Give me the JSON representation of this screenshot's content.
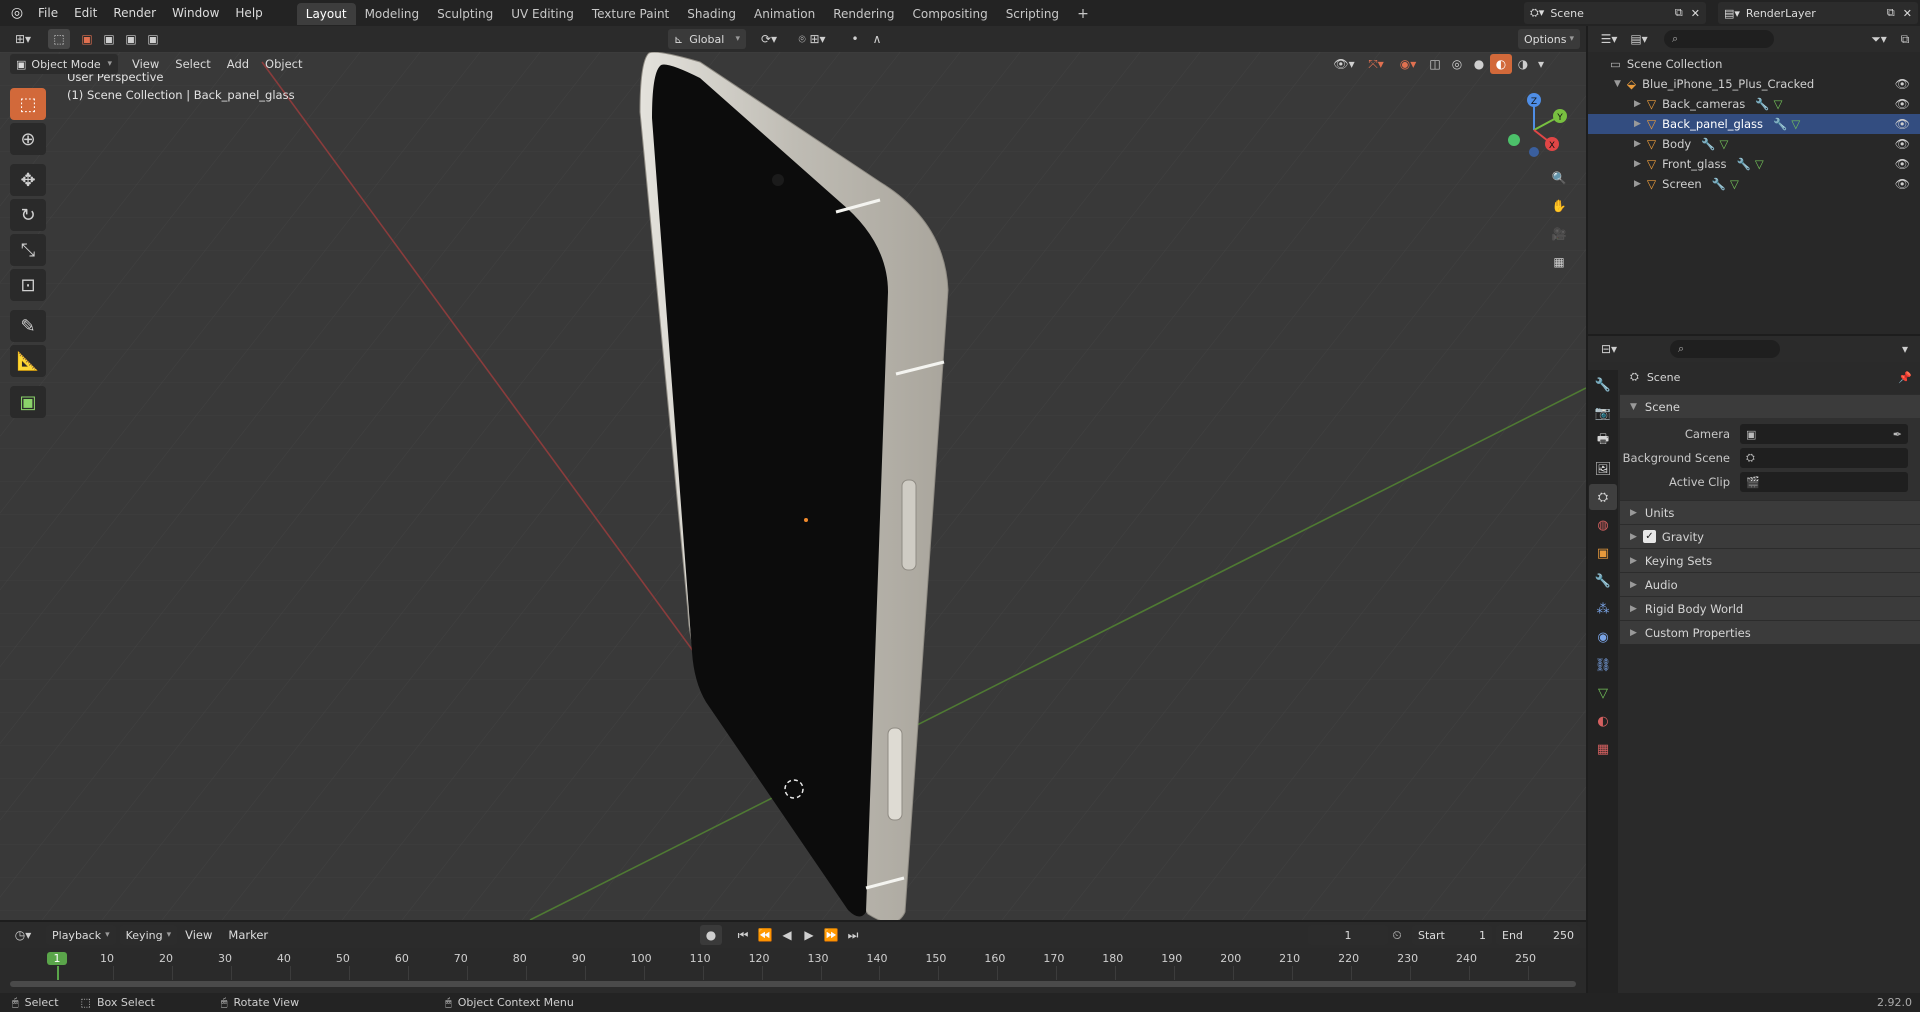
{
  "menu": [
    "File",
    "Edit",
    "Render",
    "Window",
    "Help"
  ],
  "workspaces": [
    {
      "label": "Layout",
      "active": true
    },
    {
      "label": "Modeling",
      "active": false
    },
    {
      "label": "Sculpting",
      "active": false
    },
    {
      "label": "UV Editing",
      "active": false
    },
    {
      "label": "Texture Paint",
      "active": false
    },
    {
      "label": "Shading",
      "active": false
    },
    {
      "label": "Animation",
      "active": false
    },
    {
      "label": "Rendering",
      "active": false
    },
    {
      "label": "Compositing",
      "active": false
    },
    {
      "label": "Scripting",
      "active": false
    }
  ],
  "add_workspace": "+",
  "scene_name": "Scene",
  "view_layer": "RenderLayer",
  "viewport": {
    "mode": "Object Mode",
    "menus": [
      "View",
      "Select",
      "Add",
      "Object"
    ],
    "transform_orientation": "Global",
    "options_label": "Options",
    "overlay_title": "User Perspective",
    "overlay_subtitle": "(1) Scene Collection | Back_panel_glass",
    "gizmo_axes": [
      "Z",
      "Y",
      "X"
    ]
  },
  "outliner": {
    "root": "Scene Collection",
    "collection": "Blue_iPhone_15_Plus_Cracked",
    "objects": [
      {
        "name": "Back_cameras",
        "selected": false
      },
      {
        "name": "Back_panel_glass",
        "selected": true
      },
      {
        "name": "Body",
        "selected": false
      },
      {
        "name": "Front_glass",
        "selected": false
      },
      {
        "name": "Screen",
        "selected": false
      }
    ]
  },
  "properties": {
    "context": "Scene",
    "panel": "Scene",
    "fields": [
      {
        "label": "Camera"
      },
      {
        "label": "Background Scene"
      },
      {
        "label": "Active Clip"
      }
    ],
    "subpanels": [
      "Units",
      "Gravity",
      "Keying Sets",
      "Audio",
      "Rigid Body World",
      "Custom Properties"
    ],
    "gravity_checked": true
  },
  "timeline": {
    "menus": [
      "Playback",
      "Keying",
      "View",
      "Marker"
    ],
    "current_frame": "1",
    "start_label": "Start",
    "start": "1",
    "end_label": "End",
    "end": "250",
    "ticks": [
      "1",
      "10",
      "20",
      "30",
      "40",
      "50",
      "60",
      "70",
      "80",
      "90",
      "100",
      "110",
      "120",
      "130",
      "140",
      "150",
      "160",
      "170",
      "180",
      "190",
      "200",
      "210",
      "220",
      "230",
      "240",
      "250"
    ]
  },
  "status": {
    "select": "Select",
    "box_select": "Box Select",
    "rotate_view": "Rotate View",
    "context_menu": "Object Context Menu",
    "version": "2.92.0"
  },
  "colors": {
    "accent": "#d2693a",
    "selection": "#334d80",
    "axis_x": "#e04646",
    "axis_y": "#78c040",
    "axis_z": "#4f8ee6"
  }
}
